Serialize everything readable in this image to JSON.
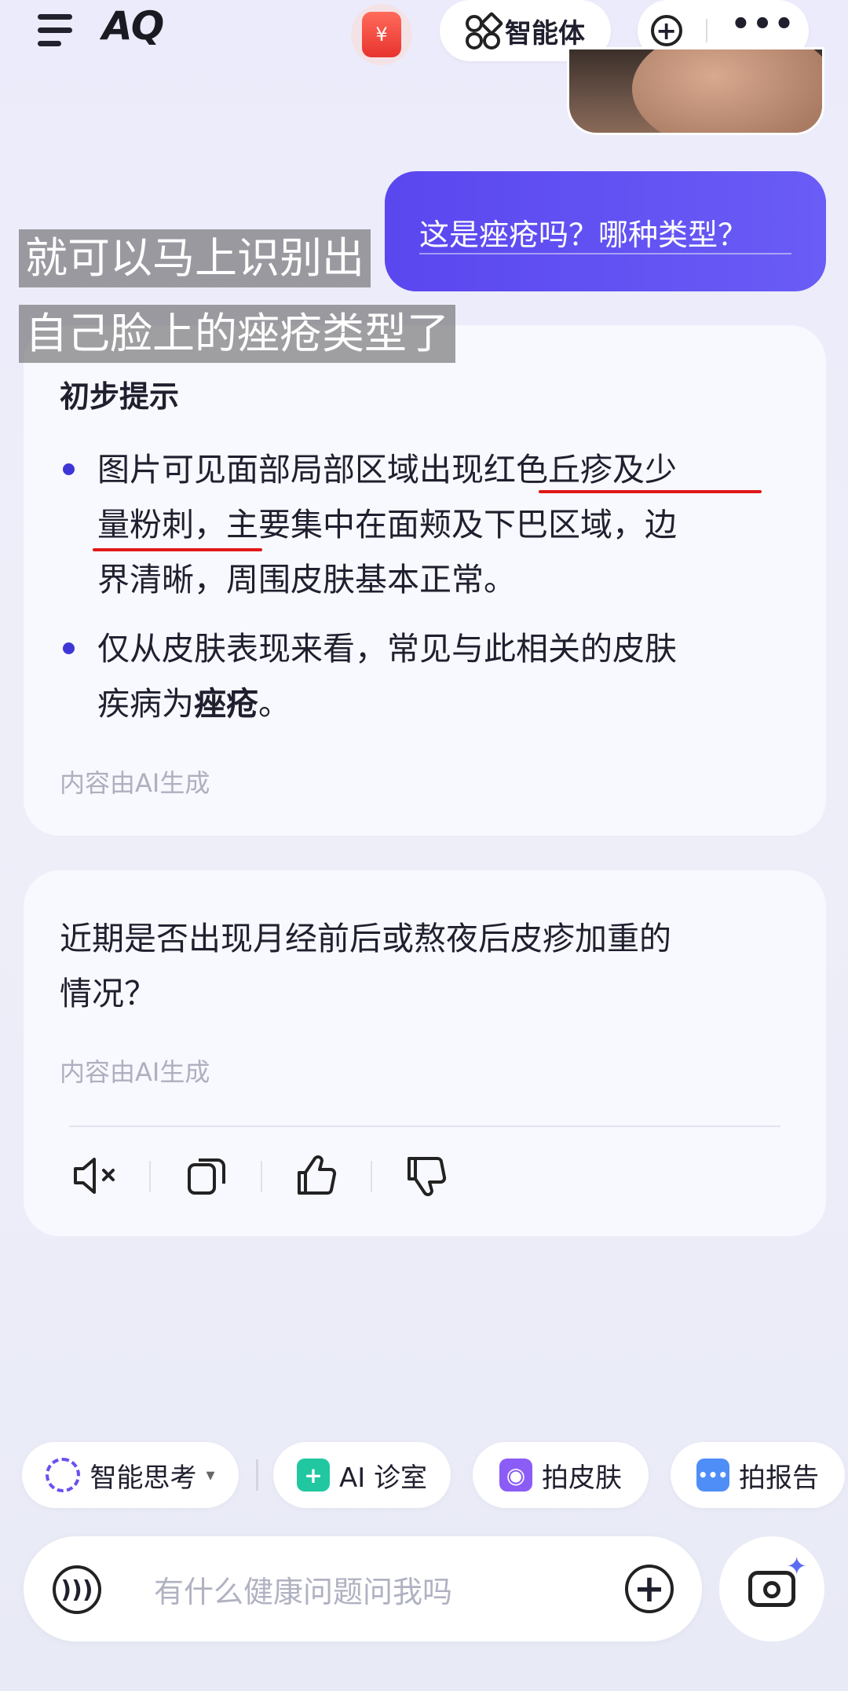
{
  "header": {
    "logo_text": "AQ",
    "redpack_symbol": "¥",
    "agent_label": "智能体",
    "more_symbol": "•••"
  },
  "chat": {
    "user_message": "这是痤疮吗？哪种类型？",
    "overlay_caption_line1": "就可以马上识别出",
    "overlay_caption_line2": "自己脸上的痤疮类型了",
    "reply1": {
      "title": "初步提示",
      "bullet1_line1": "图片可见面部局部区域出现红色丘疹及少",
      "bullet1_line2": "量粉刺，主要集中在面颊及下巴区域，边",
      "bullet1_line3": "界清晰，周围皮肤基本正常。",
      "bullet2_line1": "仅从皮肤表现来看，常见与此相关的皮肤",
      "bullet2_line2_prefix": "疾病为",
      "bullet2_line2_bold": "痤疮",
      "bullet2_line2_suffix": "。",
      "ai_note": "内容由AI生成"
    },
    "reply2": {
      "line1": "近期是否出现月经前后或熬夜后皮疹加重的",
      "line2": "情况？",
      "ai_note": "内容由AI生成"
    },
    "actions": [
      "mute-icon",
      "copy-icon",
      "thumbs-up-icon",
      "thumbs-down-icon"
    ]
  },
  "chips": {
    "deep_think": "智能思考",
    "deep_think_arrow": "▾",
    "ai_clinic": "AI 诊室",
    "skin_photo": "拍皮肤",
    "report_photo": "拍报告"
  },
  "input": {
    "placeholder": "有什么健康问题问我吗"
  },
  "colors": {
    "accent": "#5a47ef",
    "underline_red": "#e01818",
    "clinic_green": "#21c7a0",
    "skin_purple": "#8b5cf6",
    "report_blue": "#4f8ef7"
  }
}
